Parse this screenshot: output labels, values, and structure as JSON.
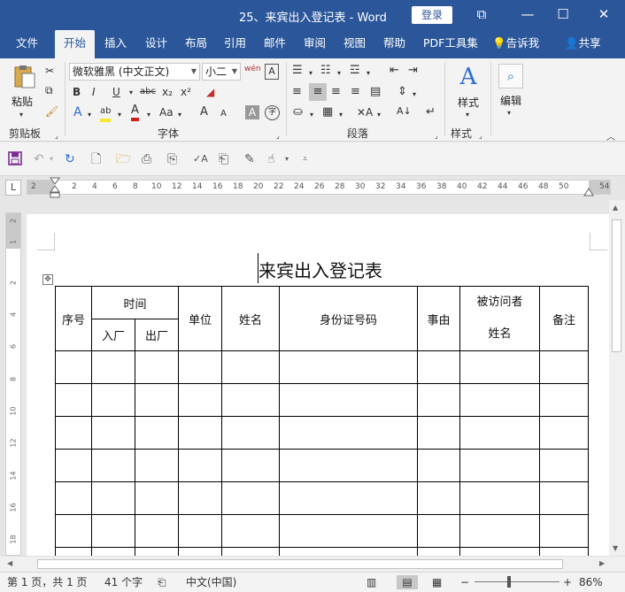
{
  "window": {
    "title": "25、来宾出入登记表  -  Word",
    "login_label": "登录",
    "controls": [
      "⧉",
      "—",
      "☐",
      "✕"
    ]
  },
  "tabs": [
    "文件",
    "开始",
    "插入",
    "设计",
    "布局",
    "引用",
    "邮件",
    "审阅",
    "视图",
    "帮助",
    "PDF工具集",
    "告诉我",
    "共享"
  ],
  "active_tab": "开始",
  "ribbon": {
    "clipboard": {
      "paste_label": "粘贴",
      "group_label": "剪贴板"
    },
    "font": {
      "font_name": "微软雅黑 (中文正文)",
      "font_size": "小二",
      "pinyin_glyph": "wén",
      "bold": "B",
      "italic": "I",
      "underline": "U",
      "strike": "abc",
      "subscript": "x₂",
      "superscript": "x²",
      "text_effect": "A",
      "highlight": "ab",
      "font_color": "A",
      "case": "Aa",
      "grow": "A",
      "shrink": "A",
      "char_shading": "A",
      "enclose": "字",
      "group_label": "字体"
    },
    "paragraph": {
      "group_label": "段落"
    },
    "styles": {
      "label": "样式",
      "group_label": "样式"
    },
    "editing": {
      "label": "编辑"
    }
  },
  "ruler": {
    "corner": "L",
    "h_ticks": [
      "2",
      "2",
      "4",
      "6",
      "8",
      "10",
      "12",
      "14",
      "16",
      "18",
      "20",
      "22",
      "24",
      "26",
      "28",
      "30",
      "32",
      "34",
      "36",
      "38",
      "40",
      "42",
      "44",
      "46",
      "48",
      "50",
      "54"
    ],
    "v_ticks": [
      "2",
      "1",
      "2",
      "4",
      "6",
      "8",
      "10",
      "12",
      "14",
      "16",
      "18"
    ]
  },
  "document": {
    "title": "来宾出入登记表",
    "table": {
      "header": {
        "seq": "序号",
        "time": "时间",
        "in": "入厂",
        "out": "出厂",
        "unit": "单位",
        "name": "姓名",
        "id": "身份证号码",
        "reason": "事由",
        "visitee_line1": "被访问者",
        "visitee_line2": "姓名",
        "remark": "备注"
      },
      "empty_rows": 7
    }
  },
  "status": {
    "page": "第 1 页，共 1 页",
    "words": "41 个字",
    "language": "中文(中国)",
    "zoom_minus": "−",
    "zoom_plus": "+",
    "zoom": "86%"
  }
}
